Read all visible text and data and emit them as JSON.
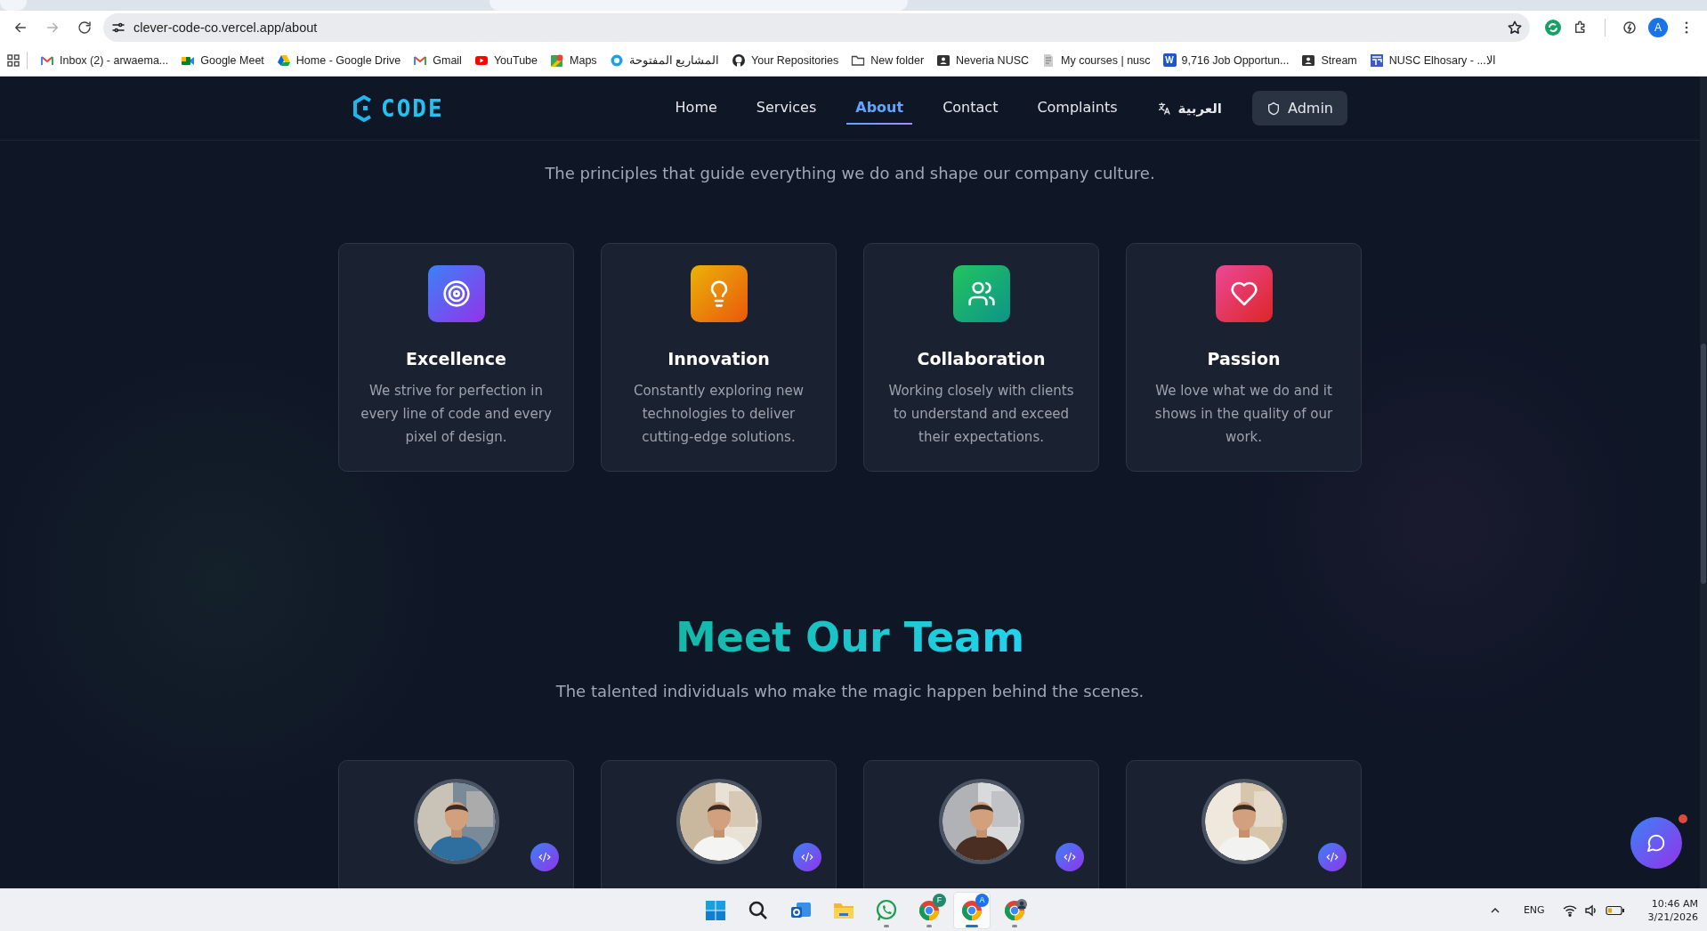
{
  "browser": {
    "url": "clever-code-co.vercel.app/about",
    "profile": "A",
    "bookmarks": [
      {
        "label": "Inbox (2) - arwaema...",
        "kind": "mail"
      },
      {
        "label": "Google Meet",
        "kind": "video"
      },
      {
        "label": "Home - Google Drive",
        "kind": "drive"
      },
      {
        "label": "Gmail",
        "kind": "mail"
      },
      {
        "label": "YouTube",
        "kind": "play"
      },
      {
        "label": "Maps",
        "kind": "map"
      },
      {
        "label": "المشاريع المفتوحة",
        "kind": "ring"
      },
      {
        "label": "Your Repositories",
        "kind": "github"
      },
      {
        "label": "New folder",
        "kind": "folder"
      },
      {
        "label": "Neveria NUSC",
        "kind": "card"
      },
      {
        "label": "My courses | nusc",
        "kind": "page"
      },
      {
        "label": "9,716 Job Opportun...",
        "kind": "letter",
        "icon_text": "W"
      },
      {
        "label": "Stream",
        "kind": "card"
      },
      {
        "label": "NUSC Elhosary - ...الا",
        "kind": "layout"
      }
    ]
  },
  "nav": {
    "logo": "CODE",
    "links": [
      {
        "label": "Home",
        "selected": false
      },
      {
        "label": "Services",
        "selected": false
      },
      {
        "label": "About",
        "selected": true
      },
      {
        "label": "Contact",
        "selected": false
      },
      {
        "label": "Complaints",
        "selected": false
      }
    ],
    "language": "العربية",
    "admin": "Admin"
  },
  "values": {
    "subtitle": "The principles that guide everything we do and shape our company culture.",
    "cards": [
      {
        "kind": "target",
        "title": "Excellence",
        "text": "We strive for perfection in every line of code and every pixel of design."
      },
      {
        "kind": "bulb",
        "title": "Innovation",
        "text": "Constantly exploring new technologies to deliver cutting-edge solutions."
      },
      {
        "kind": "users",
        "title": "Collaboration",
        "text": "Working closely with clients to understand and exceed their expectations."
      },
      {
        "kind": "heart",
        "title": "Passion",
        "text": "We love what we do and it shows in the quality of our work."
      }
    ]
  },
  "team": {
    "title": "Meet Our Team",
    "subtitle": "The talented individuals who make the magic happen behind the scenes."
  },
  "taskbar": {
    "apps": [
      {
        "kind": "start",
        "running": false,
        "selected": false
      },
      {
        "kind": "search",
        "running": false,
        "selected": false
      },
      {
        "kind": "outlook",
        "running": false,
        "selected": false
      },
      {
        "kind": "files",
        "running": false,
        "selected": false
      },
      {
        "kind": "whatsapp",
        "running": true,
        "selected": false
      },
      {
        "kind": "chrome",
        "badge": "F",
        "running": true,
        "selected": false
      },
      {
        "kind": "chrome",
        "badge": "A",
        "running": true,
        "selected": true
      },
      {
        "kind": "chrome-avatar",
        "running": true,
        "selected": false
      }
    ],
    "language": "ENG",
    "time": "10:46 AM",
    "date": "3/21/2026"
  }
}
